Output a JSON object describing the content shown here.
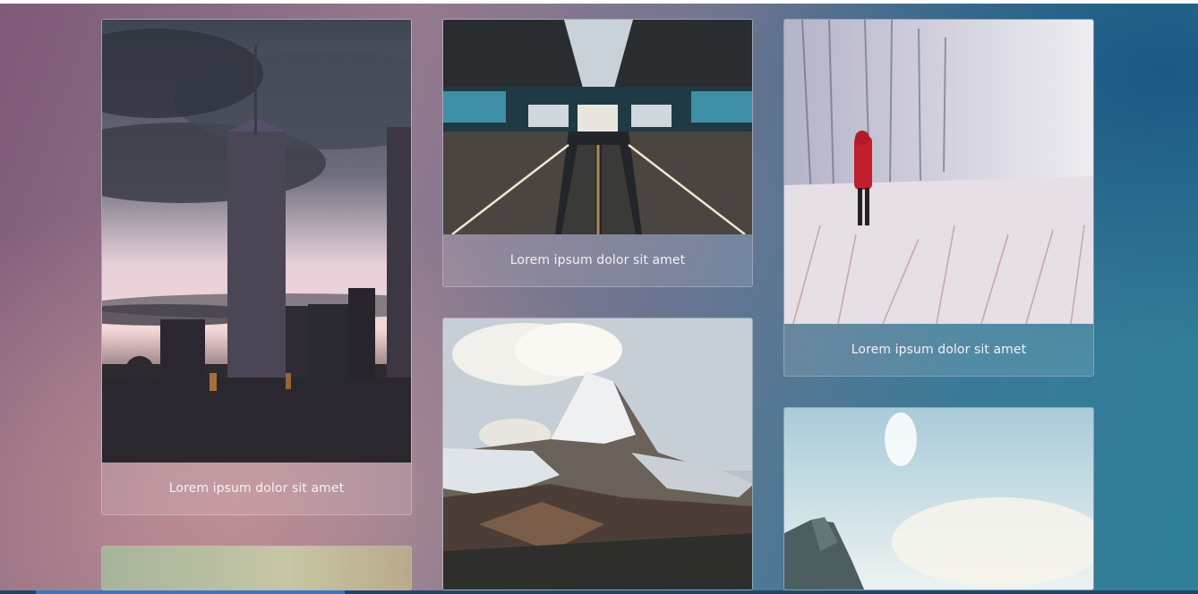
{
  "gallery": {
    "cards": [
      {
        "caption": "Lorem ipsum dolor sit amet",
        "photo": "city-skyline-photo"
      },
      {
        "caption": "Lorem ipsum dolor sit amet",
        "photo": "escalator-photo"
      },
      {
        "caption": "Lorem ipsum dolor sit amet",
        "photo": "snow-hiker-photo"
      },
      {
        "caption": "",
        "photo": "mountain-peak-photo"
      },
      {
        "caption": "",
        "photo": "sky-cliff-photo"
      },
      {
        "caption": "",
        "photo": "bottom-left-photo"
      }
    ]
  },
  "colors": {
    "background_left": "#7d5a78",
    "background_right": "#2f7f97",
    "caption_text": "#f4f1f5"
  }
}
